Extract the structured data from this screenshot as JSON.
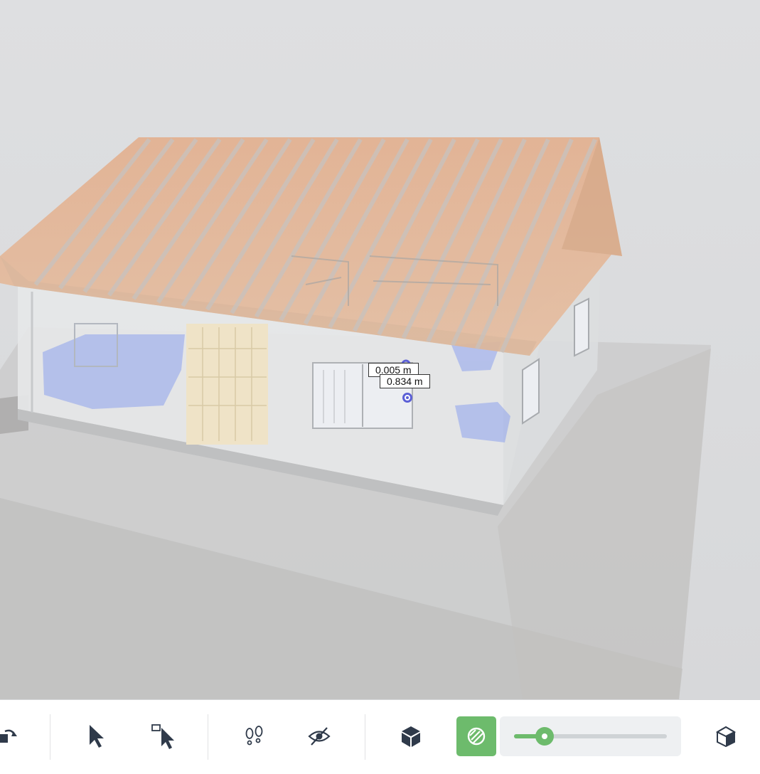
{
  "viewport": {
    "measurements": [
      {
        "value": "0.005 m"
      },
      {
        "value": "0.834 m"
      }
    ]
  },
  "toolbar": {
    "buttons": [
      {
        "name": "rotate-view-button",
        "icon": "rotate-cube-icon"
      },
      {
        "name": "select-button",
        "icon": "arrow-cursor-icon"
      },
      {
        "name": "box-select-button",
        "icon": "box-select-cursor-icon"
      },
      {
        "name": "walk-mode-button",
        "icon": "footsteps-icon"
      },
      {
        "name": "hide-button",
        "icon": "eye-slash-icon"
      },
      {
        "name": "solid-view-button",
        "icon": "solid-cube-icon"
      },
      {
        "name": "xray-button",
        "icon": "xray-icon",
        "active": true
      },
      {
        "name": "wireframe-cube-button",
        "icon": "outline-cube-icon"
      }
    ],
    "opacity_slider": {
      "value": 0.2
    }
  },
  "colors": {
    "accent": "#6dbb6c",
    "measurement_point": "#5b5fd6",
    "toolbar_icon": "#2f3a4a"
  }
}
